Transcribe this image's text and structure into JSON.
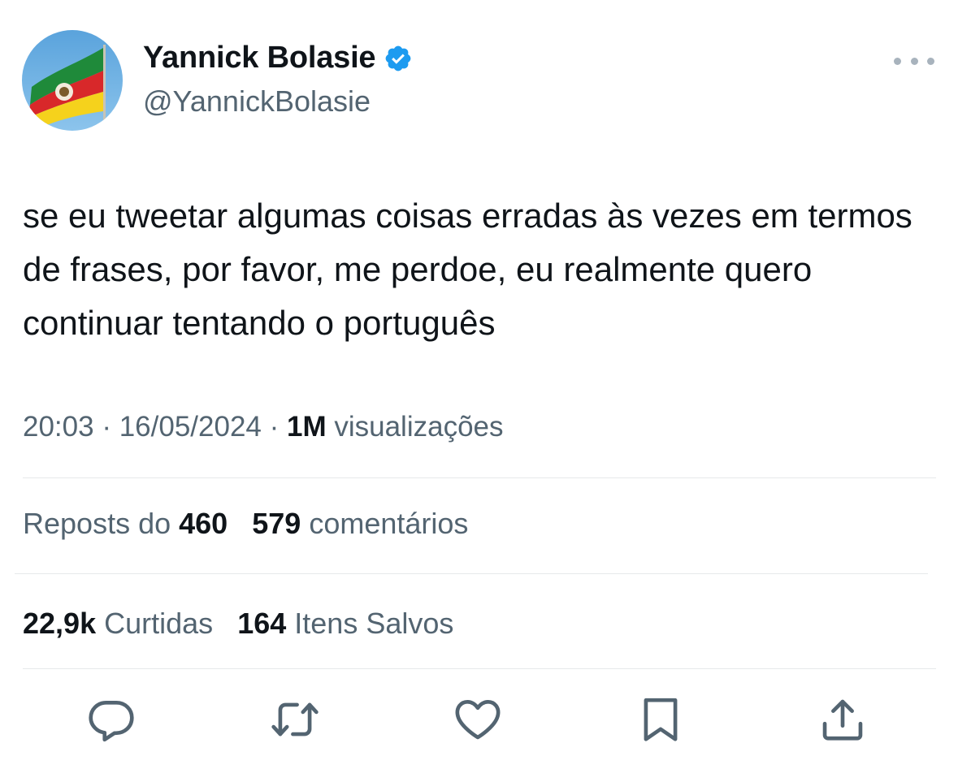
{
  "author": {
    "name": "Yannick Bolasie",
    "handle": "@YannickBolasie",
    "verified": true,
    "verified_color": "#1d9bf0"
  },
  "tweet": {
    "text": "se eu tweetar algumas coisas erradas às vezes em termos de frases, por favor, me perdoe, eu realmente quero continuar tentando o português",
    "time": "20:03",
    "separator1": " · ",
    "date": "16/05/2024",
    "separator2": " · ",
    "views_count": "1M",
    "views_label": "visualizações"
  },
  "stats": {
    "reposts_label": "Reposts do",
    "reposts_count": "460",
    "comments_count": "579",
    "comments_label": "comentários",
    "likes_count": "22,9k",
    "likes_label": "Curtidas",
    "saves_count": "164",
    "saves_label": "Itens Salvos"
  },
  "actions": {
    "reply_icon": "comment-icon",
    "repost_icon": "repost-icon",
    "like_icon": "heart-icon",
    "bookmark_icon": "bookmark-icon",
    "share_icon": "share-icon"
  },
  "colors": {
    "text_primary": "#0f1419",
    "text_secondary": "#536471",
    "icon": "#536471",
    "divider": "#e6e9eb"
  }
}
